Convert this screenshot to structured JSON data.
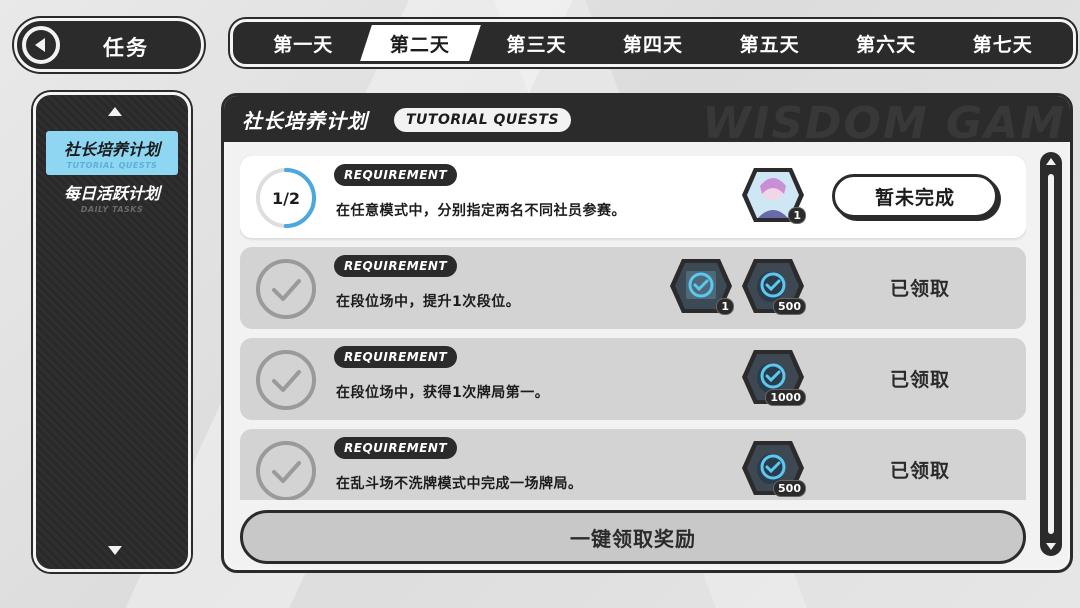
{
  "header": {
    "title": "任务"
  },
  "day_tabs": [
    {
      "label": "第一天",
      "active": false
    },
    {
      "label": "第二天",
      "active": true
    },
    {
      "label": "第三天",
      "active": false
    },
    {
      "label": "第四天",
      "active": false
    },
    {
      "label": "第五天",
      "active": false
    },
    {
      "label": "第六天",
      "active": false
    },
    {
      "label": "第七天",
      "active": false
    }
  ],
  "sidebar": {
    "items": [
      {
        "label": "社长培养计划",
        "sublabel": "TUTORIAL QUESTS",
        "active": true
      },
      {
        "label": "每日活跃计划",
        "sublabel": "DAILY TASKS",
        "active": false
      }
    ]
  },
  "panel": {
    "title": "社长培养计划",
    "tag": "TUTORIAL QUESTS",
    "watermark": "WISDOM GAM",
    "claim_all_label": "一键领取奖励"
  },
  "quests": [
    {
      "requirement_label": "REQUIREMENT",
      "description": "在任意模式中，分别指定两名不同社员参赛。",
      "progress": "1/2",
      "progress_fraction": 0.5,
      "status": "暂未完成",
      "completed": false,
      "rewards": [
        {
          "icon": "character-avatar-icon",
          "count": "1"
        }
      ]
    },
    {
      "requirement_label": "REQUIREMENT",
      "description": "在段位场中，提升1次段位。",
      "status": "已领取",
      "completed": true,
      "rewards": [
        {
          "icon": "item-card-icon",
          "count": "1"
        },
        {
          "icon": "currency-icon",
          "count": "500"
        }
      ]
    },
    {
      "requirement_label": "REQUIREMENT",
      "description": "在段位场中，获得1次牌局第一。",
      "status": "已领取",
      "completed": true,
      "rewards": [
        {
          "icon": "currency-icon",
          "count": "1000"
        }
      ]
    },
    {
      "requirement_label": "REQUIREMENT",
      "description": "在乱斗场不洗牌模式中完成一场牌局。",
      "status": "已领取",
      "completed": true,
      "rewards": [
        {
          "icon": "currency-icon",
          "count": "500"
        }
      ]
    }
  ],
  "colors": {
    "dark": "#2b2b2b",
    "accent": "#8ed6f2",
    "progress_ring": "#4aa8de",
    "completed_card": "#d3d3d3"
  }
}
